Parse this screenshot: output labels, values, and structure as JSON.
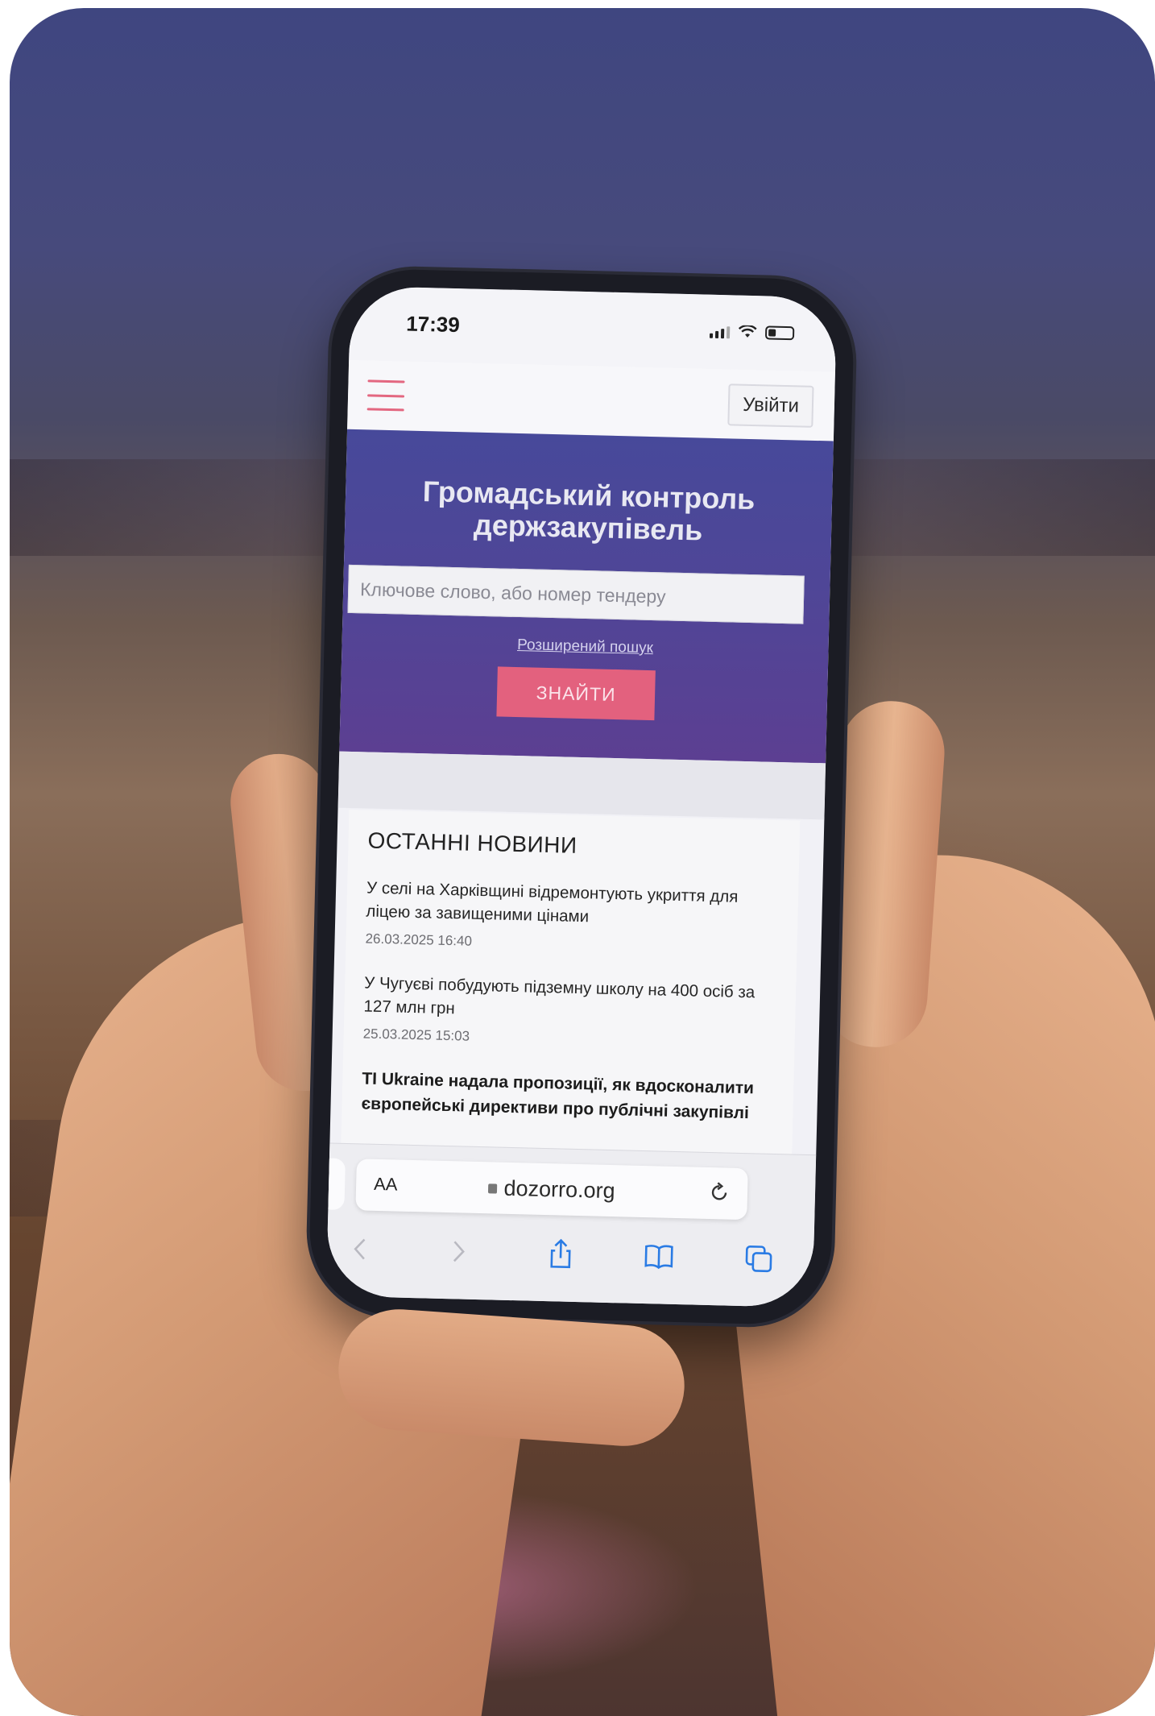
{
  "status_bar": {
    "time": "17:39"
  },
  "site": {
    "login_label": "Увійти",
    "hero_title_line1": "Громадський контроль",
    "hero_title_line2": "держзакупівель",
    "search_placeholder": "Ключове слово, або номер тендеру",
    "advanced_search_label": "Розширений пошук",
    "find_button_label": "ЗНАЙТИ",
    "accent_color": "#e3617e",
    "hero_color": "#4b4899"
  },
  "news": {
    "heading": "ОСТАННІ НОВИНИ",
    "items": [
      {
        "title": "У селі на Харківщині відремонтують укриття для ліцею за завищеними цінами",
        "date": "26.03.2025 16:40"
      },
      {
        "title": "У Чугуєві побудують підземну школу на 400 осіб за 127 млн грн",
        "date": "25.03.2025 15:03"
      },
      {
        "title": "TI Ukraine надала пропозиції, як вдосконалити європейські директиви про публічні закупівлі",
        "date": ""
      }
    ]
  },
  "browser": {
    "text_size_label": "AA",
    "url": "dozorro.org",
    "icons": [
      "back-icon",
      "forward-icon",
      "share-icon",
      "bookmarks-icon",
      "tabs-icon",
      "reload-icon",
      "lock-icon"
    ]
  }
}
